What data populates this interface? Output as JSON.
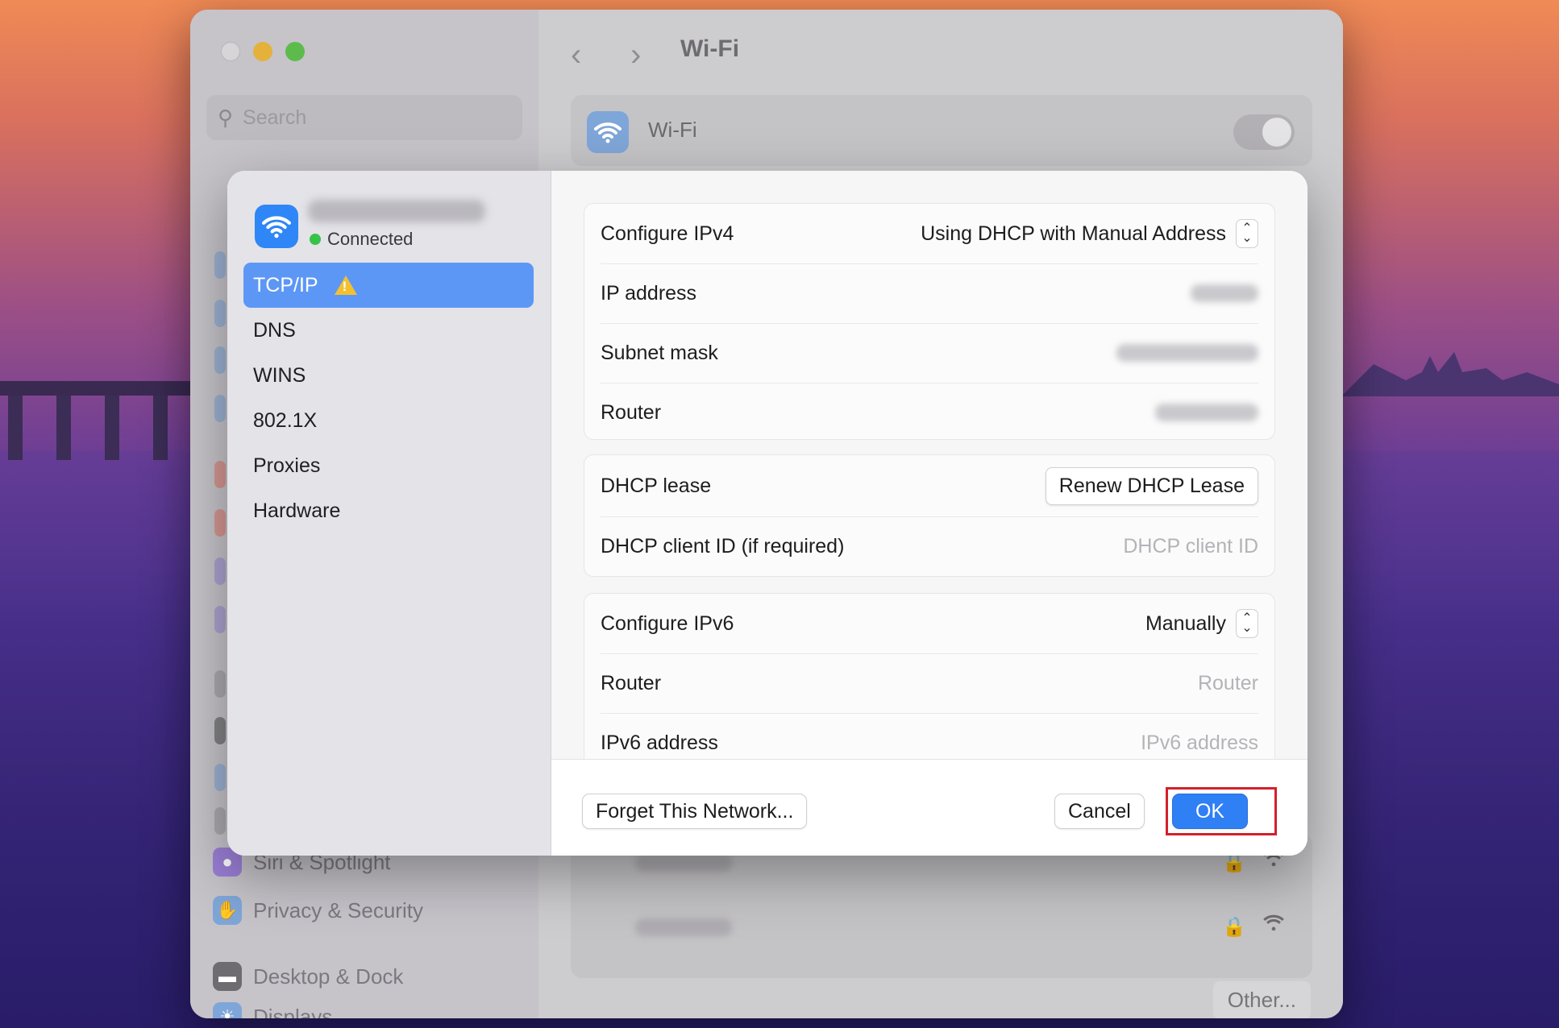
{
  "window": {
    "title": "Wi-Fi",
    "search_placeholder": "Search",
    "wifi_label": "Wi-Fi",
    "other_button": "Other...",
    "sidebar_items": [
      {
        "label": "Siri & Spotlight",
        "icon": "siri-icon"
      },
      {
        "label": "Privacy & Security",
        "icon": "hand-icon"
      },
      {
        "label": "Desktop & Dock",
        "icon": "dock-icon"
      },
      {
        "label": "Displays",
        "icon": "sun-icon"
      }
    ]
  },
  "dialog": {
    "status": "Connected",
    "tabs": [
      "TCP/IP",
      "DNS",
      "WINS",
      "802.1X",
      "Proxies",
      "Hardware"
    ],
    "ipv4": {
      "configure_label": "Configure IPv4",
      "configure_value": "Using DHCP with Manual Address",
      "ip_label": "IP address",
      "subnet_label": "Subnet mask",
      "router_label": "Router"
    },
    "dhcp": {
      "lease_label": "DHCP lease",
      "renew_button": "Renew DHCP Lease",
      "client_id_label": "DHCP client ID (if required)",
      "client_id_placeholder": "DHCP client ID"
    },
    "ipv6": {
      "configure_label": "Configure IPv6",
      "configure_value": "Manually",
      "router_label": "Router",
      "router_placeholder": "Router",
      "address_label": "IPv6 address",
      "address_placeholder": "IPv6 address"
    },
    "footer": {
      "forget_button": "Forget This Network...",
      "cancel_button": "Cancel",
      "ok_button": "OK"
    }
  },
  "colors": {
    "accent": "#2f7ff5",
    "highlight_box": "#d3202a",
    "connected": "#37c24a",
    "warning": "#f3c12f"
  }
}
